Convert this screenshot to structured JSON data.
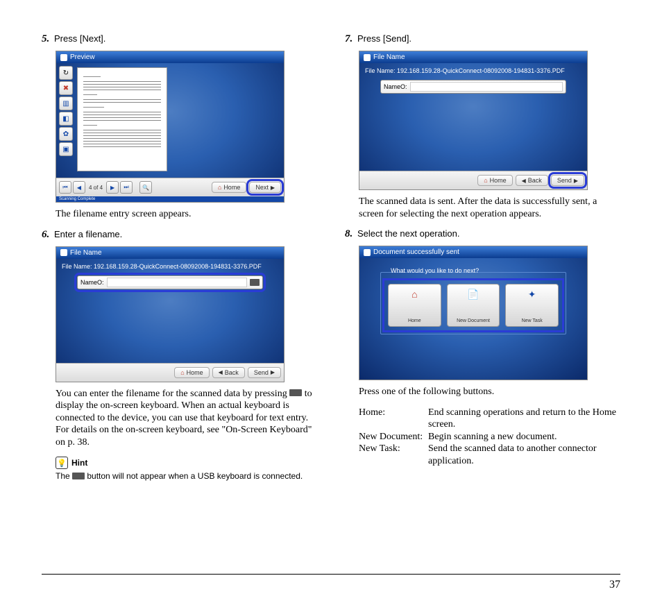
{
  "page_number": "37",
  "left": {
    "step5_num": "5.",
    "step5_text": "Press [Next].",
    "after5": "The filename entry screen appears.",
    "step6_num": "6.",
    "step6_text": "Enter a filename.",
    "after6": "You can enter the filename for the scanned data by pressing ⌨ to display the on-screen keyboard. When an actual keyboard is connected to the device, you can use that keyboard for text entry. For details on the on-screen keyboard, see \"On-Screen Keyboard\" on p. 38.",
    "hint_label": "Hint",
    "hint_text": "The ⌨ button will not appear when a USB keyboard is connected.",
    "shotA": {
      "title": "Preview",
      "page_of": "4 of 4",
      "home": "Home",
      "next": "Next",
      "footer_status": "Scanning Complete"
    },
    "shotB": {
      "title": "File Name",
      "file_label": "File Name:",
      "file_path": "192.168.159.28-QuickConnect-08092008-194831-3376.PDF",
      "name_label": "NameO:",
      "home": "Home",
      "back": "Back",
      "send": "Send"
    }
  },
  "right": {
    "step7_num": "7.",
    "step7_text": "Press [Send].",
    "after7": "The scanned data is sent. After the data is successfully sent, a screen for selecting the next operation appears.",
    "step8_num": "8.",
    "step8_text": "Select the next operation.",
    "after8_intro": "Press one of the following buttons.",
    "defs": {
      "home_t": "Home:",
      "home_d": "End scanning operations and return to the Home screen.",
      "newdoc_t": "New Document:",
      "newdoc_d": "Begin scanning a new document.",
      "newtask_t": "New Task:",
      "newtask_d": "Send the scanned data to another connector application."
    },
    "shotC": {
      "title": "File Name",
      "file_label": "File Name:",
      "file_path": "192.168.159.28-QuickConnect-08092008-194831-3376.PDF",
      "name_label": "NameO:",
      "home": "Home",
      "back": "Back",
      "send": "Send"
    },
    "shotD": {
      "title": "Document successfully sent",
      "prompt": "What would you like to do next?",
      "btn_home": "Home",
      "btn_newdoc": "New Document",
      "btn_newtask": "New Task"
    }
  }
}
